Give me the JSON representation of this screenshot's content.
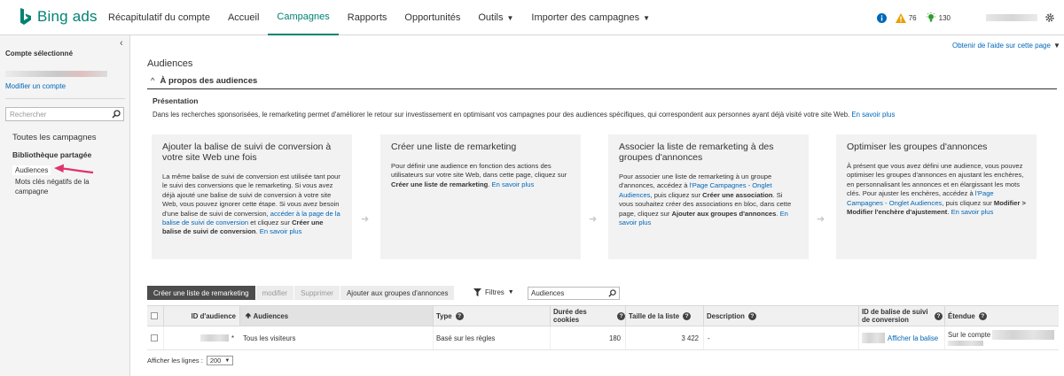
{
  "colors": {
    "brand": "#008272",
    "link": "#0067b8",
    "alert_orange": "#e8a000",
    "info_blue": "#0067b8",
    "idea_green": "#2e9b2e",
    "annotation_arrow": "#e0336b"
  },
  "header": {
    "logo_text": "Bing ads",
    "nav": [
      {
        "label": "Récapitulatif du compte",
        "active": false,
        "dropdown": false
      },
      {
        "label": "Accueil",
        "active": false,
        "dropdown": false
      },
      {
        "label": "Campagnes",
        "active": true,
        "dropdown": false
      },
      {
        "label": "Rapports",
        "active": false,
        "dropdown": false
      },
      {
        "label": "Opportunités",
        "active": false,
        "dropdown": false
      },
      {
        "label": "Outils",
        "active": false,
        "dropdown": true
      },
      {
        "label": "Importer des campagnes",
        "active": false,
        "dropdown": true
      }
    ],
    "indicators": {
      "alerts_count": "76",
      "ideas_count": "130"
    },
    "icons": {
      "info": "info-icon",
      "alert": "warning-icon",
      "ideas": "lightbulb-icon",
      "settings": "gear-icon"
    }
  },
  "sidebar": {
    "selected_account_label": "Compte sélectionné",
    "modify_account_link": "Modifier un compte",
    "search_placeholder": "Rechercher",
    "all_campaigns": "Toutes les campagnes",
    "shared_library": "Bibliothèque partagée",
    "audiences": "Audiences",
    "negative_keywords": "Mots clés négatifs de la campagne"
  },
  "main": {
    "help_link": "Obtenir de l'aide sur cette page",
    "page_title": "Audiences",
    "about_title": "À propos des audiences",
    "presentation_title": "Présentation",
    "presentation_text": "Dans les recherches sponsorisées, le remarketing permet d'améliorer le retour sur investissement en optimisant vos campagnes pour des audiences spécifiques, qui correspondent aux personnes ayant déjà visité votre site Web.",
    "learn_more": "En savoir plus",
    "cards": [
      {
        "title": "Ajouter la balise de suivi de conversion à votre site Web une fois",
        "t1": "La même balise de suivi de conversion est utilisée tant pour le suivi des conversions que le remarketing. Si vous avez déjà ajouté une balise de suivi de conversion à votre site Web, vous pouvez ignorer cette étape. Si vous avez besoin d'une balise de suivi de conversion, ",
        "l1": "accéder à la page de la balise de suivi de conversion",
        "t2": " et cliquez sur ",
        "b1": "Créer une balise de suivi de conversion",
        "t3": ". ",
        "more": "En savoir plus"
      },
      {
        "title": "Créer une liste de remarketing",
        "t1": "Pour définir une audience en fonction des actions des utilisateurs sur votre site Web, dans cette page, cliquez sur ",
        "b1": "Créer une liste de remarketing",
        "t2": ". ",
        "more": "En savoir plus"
      },
      {
        "title": "Associer la liste de remarketing à des groupes d'annonces",
        "t1": "Pour associer une liste de remarketing à un groupe d'annonces, accédez à ",
        "l1": "l'Page Campagnes - Onglet Audiences",
        "t2": ", puis cliquez sur ",
        "b1": "Créer une association",
        "t3": ". Si vous souhaitez créer des associations en bloc, dans cette page, cliquez sur ",
        "b2": "Ajouter aux groupes d'annonces",
        "t4": ". ",
        "more": "En savoir plus"
      },
      {
        "title": "Optimiser les groupes d'annonces",
        "t1": "À présent que vous avez défini une audience, vous pouvez optimiser les groupes d'annonces en ajustant les enchères, en personnalisant les annonces et en élargissant les mots clés. Pour ajuster les enchères, accédez à ",
        "l1": "l'Page Campagnes - Onglet Audiences",
        "t2": ", puis cliquez sur ",
        "b1": "Modifier > Modifier l'enchère d'ajustement",
        "t3": ". ",
        "more": "En savoir plus"
      }
    ],
    "toolbar": {
      "create_list": "Créer une liste de remarketing",
      "modify": "modifier",
      "delete": "Supprimer",
      "add_to_groups": "Ajouter aux groupes d'annonces",
      "filters": "Filtres",
      "filter_value": "Audiences"
    },
    "table": {
      "columns": {
        "id": "ID d'audience",
        "audiences": "Audiences",
        "type": "Type",
        "duration": "Durée des cookies",
        "size": "Taille de la liste",
        "description": "Description",
        "tag_id": "ID de balise de suivi de conversion",
        "scope": "Étendue"
      },
      "rows": [
        {
          "id_suffix": "*",
          "audience": "Tous les visiteurs",
          "type": "Basé sur les règles",
          "duration": "180",
          "size": "3 422",
          "description": "-",
          "show_tag": "Afficher la balise",
          "scope": "Sur le compte"
        }
      ]
    },
    "footer": {
      "rows_label": "Afficher les lignes :",
      "rows_value": "200"
    }
  }
}
